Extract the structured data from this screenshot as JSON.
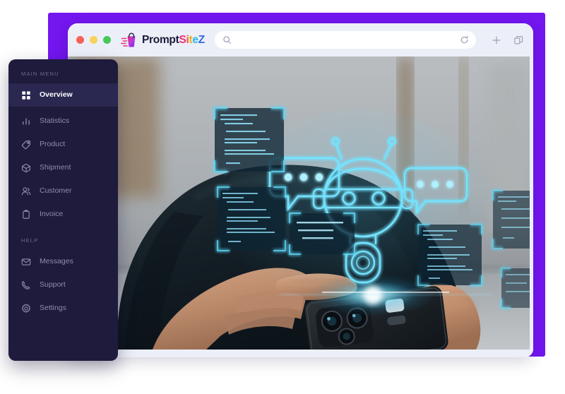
{
  "frame": {
    "accent_purple": "#7416F0"
  },
  "browser": {
    "window_controls": [
      {
        "name": "close",
        "color": "#F8615A"
      },
      {
        "name": "minimize",
        "color": "#F8D35A"
      },
      {
        "name": "zoom",
        "color": "#46C85A"
      }
    ],
    "logo": {
      "icon": "shopping-bag-icon",
      "text_primary": "Prompt",
      "text_accent": "SiteZ",
      "accent_letters": [
        {
          "char": "S",
          "color": "#F0307A"
        },
        {
          "char": "i",
          "color": "#F55F2A"
        },
        {
          "char": "t",
          "color": "#F0A81E"
        },
        {
          "char": "e",
          "color": "#2AB5E8"
        },
        {
          "char": "Z",
          "color": "#2F6CE5"
        }
      ]
    },
    "addressbar": {
      "search_icon": "search-icon",
      "value": "",
      "placeholder": "",
      "reload_icon": "reload-icon"
    },
    "toolbar_right": [
      {
        "name": "new-tab-button",
        "icon": "plus-icon"
      },
      {
        "name": "duplicate-tab-button",
        "icon": "copy-icon"
      }
    ]
  },
  "sidebar": {
    "sections": [
      {
        "label": "MAIN MENU",
        "items": [
          {
            "label": "Overview",
            "icon": "grid-icon",
            "active": true
          },
          {
            "label": "Statistics",
            "icon": "bar-chart-icon",
            "active": false
          },
          {
            "label": "Product",
            "icon": "tag-icon",
            "active": false
          },
          {
            "label": "Shipment",
            "icon": "package-icon",
            "active": false
          },
          {
            "label": "Customer",
            "icon": "users-icon",
            "active": false
          },
          {
            "label": "Invoice",
            "icon": "clipboard-icon",
            "active": false
          }
        ]
      },
      {
        "label": "HELP",
        "items": [
          {
            "label": "Messages",
            "icon": "envelope-icon",
            "active": false
          },
          {
            "label": "Support",
            "icon": "phone-icon",
            "active": false
          },
          {
            "label": "Settings",
            "icon": "gear-icon",
            "active": false
          }
        ]
      }
    ]
  },
  "page_photo": {
    "alt": "Person in dark sweater holding a smartphone with a glowing cyan AI chatbot hologram, speech bubbles and floating code snippet panels"
  }
}
